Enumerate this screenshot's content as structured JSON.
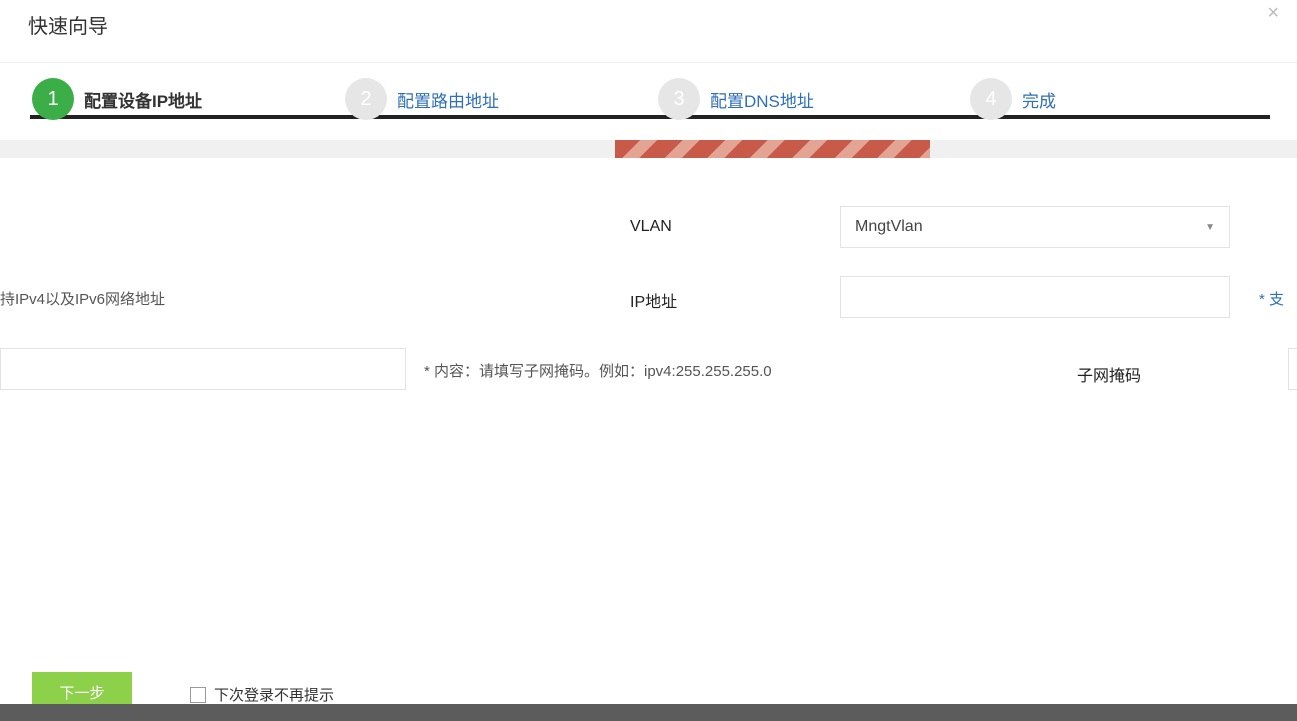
{
  "dialog": {
    "title": "快速向导",
    "close_label": "×"
  },
  "steps": [
    {
      "number": "1",
      "label": "配置设备IP地址"
    },
    {
      "number": "2",
      "label": "配置路由地址"
    },
    {
      "number": "3",
      "label": "配置DNS地址"
    },
    {
      "number": "4",
      "label": "完成"
    }
  ],
  "form": {
    "vlan": {
      "label": "VLAN",
      "value": "MngtVlan"
    },
    "ip": {
      "label": "IP地址",
      "value": "",
      "hint_left": "持IPv4以及IPv6网络地址",
      "hint_right": "* 支"
    },
    "mask": {
      "label": "子网掩码",
      "hint": "* 内容：请填写子网掩码。例如：ipv4:255.255.255.0"
    }
  },
  "footer": {
    "next_label": "下一步",
    "dont_remind_label": "下次登录不再提示"
  },
  "colors": {
    "active_step": "#3cae48",
    "next_button": "#8dd04a",
    "link": "#2e6fb8"
  }
}
